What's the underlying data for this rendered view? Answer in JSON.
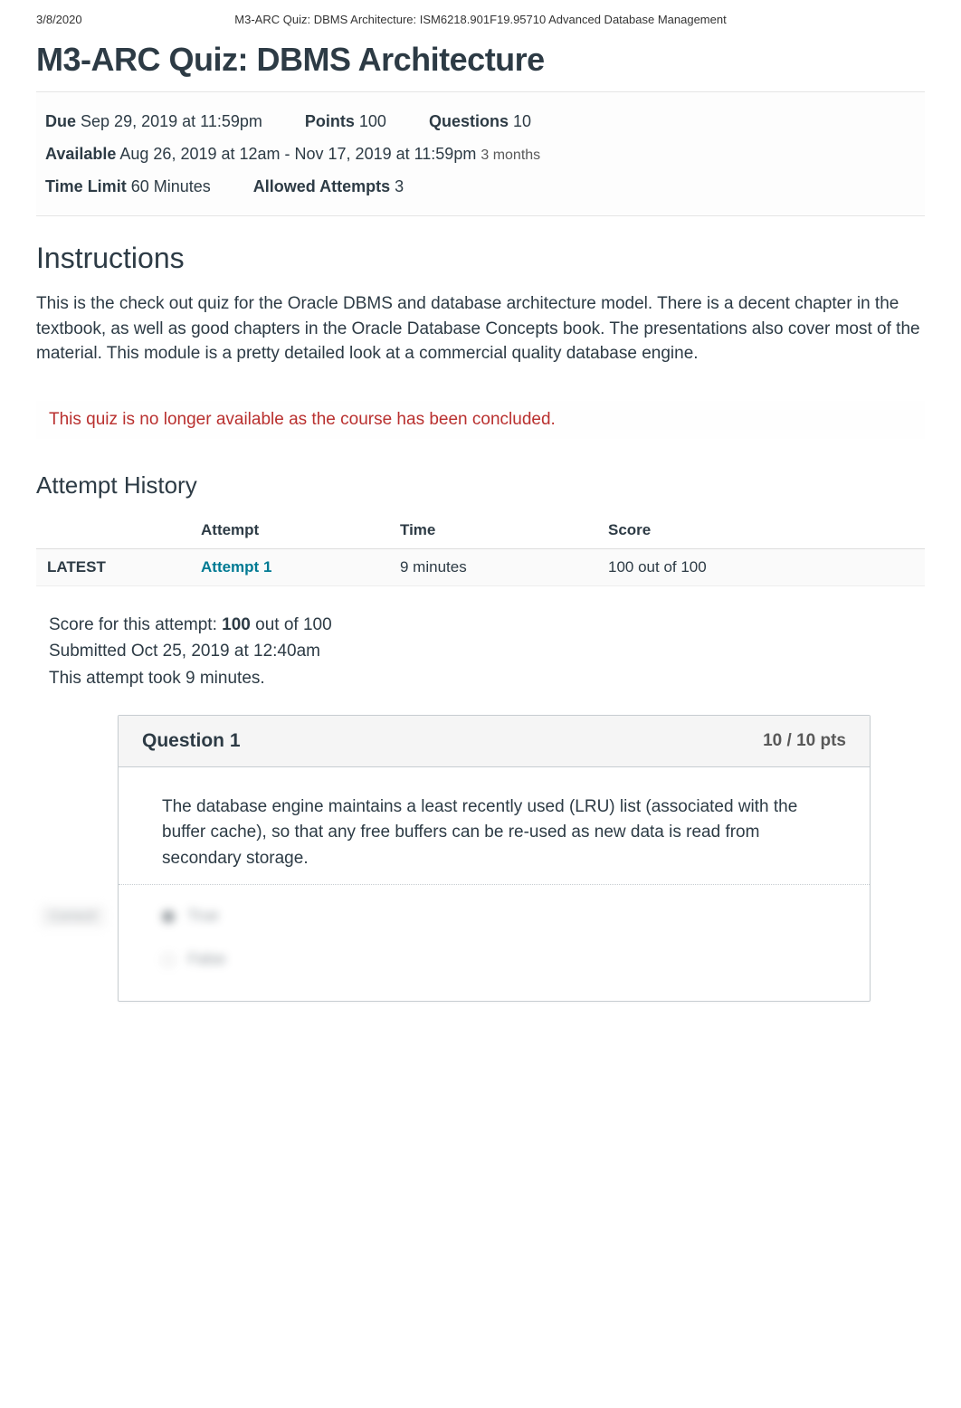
{
  "print_header": {
    "date": "3/8/2020",
    "title": "M3-ARC Quiz: DBMS Architecture: ISM6218.901F19.95710 Advanced Database Management"
  },
  "page": {
    "title": "M3-ARC Quiz: DBMS Architecture"
  },
  "meta": {
    "due_label": "Due",
    "due_value": "Sep 29, 2019 at 11:59pm",
    "points_label": "Points",
    "points_value": "100",
    "questions_label": "Questions",
    "questions_value": "10",
    "available_label": "Available",
    "available_value": "Aug 26, 2019 at 12am - Nov 17, 2019 at 11:59pm",
    "available_duration": "3 months",
    "time_limit_label": "Time Limit",
    "time_limit_value": "60 Minutes",
    "allowed_attempts_label": "Allowed Attempts",
    "allowed_attempts_value": "3"
  },
  "instructions": {
    "heading": "Instructions",
    "body": "This is the check out quiz for the Oracle DBMS and database architecture model.  There is a decent chapter in the textbook, as well as good chapters in the Oracle Database Concepts book.  The presentations also cover most of the material.  This module is a pretty detailed look at a commercial quality database engine."
  },
  "alert": "This quiz is no longer available as the course has been concluded.",
  "attempt_history": {
    "heading": "Attempt History",
    "columns": {
      "blank": "",
      "attempt": "Attempt",
      "time": "Time",
      "score": "Score"
    },
    "rows": [
      {
        "latest": "LATEST",
        "attempt": "Attempt 1",
        "time": "9 minutes",
        "score": "100 out of 100"
      }
    ]
  },
  "summary": {
    "score_prefix": "Score for this attempt: ",
    "score_value": "100",
    "score_suffix": " out of 100",
    "submitted": "Submitted Oct 25, 2019 at 12:40am",
    "took": "This attempt took 9 minutes."
  },
  "question1": {
    "title": "Question 1",
    "points": "10 / 10 pts",
    "text": "The database engine maintains a least recently used (LRU) list (associated with the buffer cache), so that any free buffers can be re-used as new data is read from secondary storage.",
    "correct_badge": "Correct!",
    "answer_true": "True",
    "answer_false": "False"
  }
}
